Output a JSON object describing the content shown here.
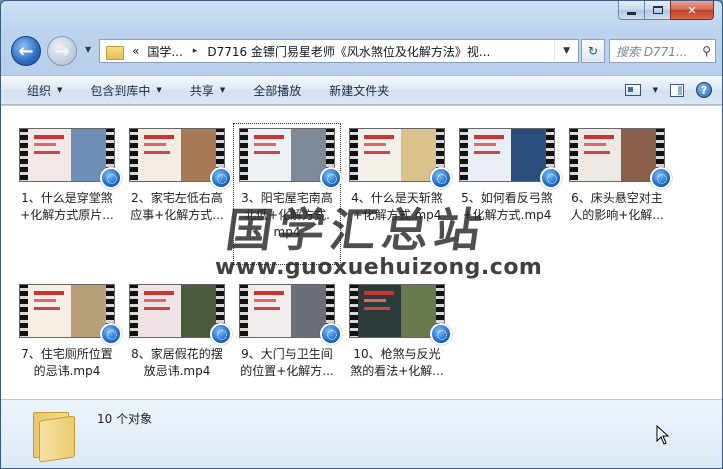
{
  "window": {
    "controls": {
      "minimize": "",
      "maximize": "",
      "close": "✕"
    }
  },
  "address": {
    "breadcrumbs": [
      "«",
      "国学...",
      "D7716 金镖门易星老师《风水煞位及化解方法》视..."
    ],
    "separator": "▸",
    "refresh": "↻",
    "search_placeholder": "搜索 D771...",
    "search_icon": "search-icon"
  },
  "toolbar": {
    "organize": "组织",
    "include_in_library": "包含到库中",
    "share": "共享",
    "play_all": "全部播放",
    "new_folder": "新建文件夹",
    "help": "?"
  },
  "files": [
    {
      "label": "1、什么是穿堂煞\n+化解方式原片...",
      "colors": [
        "#f3e8e8",
        "#6f8fb8"
      ]
    },
    {
      "label": "2、家宅左低右高\n应事+化解方式...",
      "colors": [
        "#f2ece4",
        "#a77a55"
      ]
    },
    {
      "label": "3、阳宅屋宅南高\n北低+化解方式.\nmp4",
      "colors": [
        "#eef1f4",
        "#7e8a97"
      ]
    },
    {
      "label": "4、什么是天斩煞\n+化解方式.mp4",
      "colors": [
        "#f4f0e9",
        "#d9c28e"
      ]
    },
    {
      "label": "5、如何看反弓煞\n+化解方式.mp4",
      "colors": [
        "#e9eef5",
        "#2b4e7d"
      ]
    },
    {
      "label": "6、床头悬空对主\n人的影响+化解...",
      "colors": [
        "#efe9e6",
        "#8a5f4b"
      ]
    },
    {
      "label": "7、住宅厕所位置\n的忌讳.mp4",
      "colors": [
        "#f5efe6",
        "#b79f79"
      ]
    },
    {
      "label": "8、家居假花的摆\n放忌讳.mp4",
      "colors": [
        "#f0e3e5",
        "#4b5a3a"
      ]
    },
    {
      "label": "9、大门与卫生间\n的位置+化解方...",
      "colors": [
        "#f3ecec",
        "#6b6f78"
      ]
    },
    {
      "label": "10、枪煞与反光\n煞的看法+化解...",
      "colors": [
        "#2c3a3a",
        "#6a7a4e"
      ]
    }
  ],
  "watermark": {
    "chinese": "国学汇总站",
    "url": "www.guoxuehuizong.com"
  },
  "status": {
    "count_text": "10 个对象"
  }
}
